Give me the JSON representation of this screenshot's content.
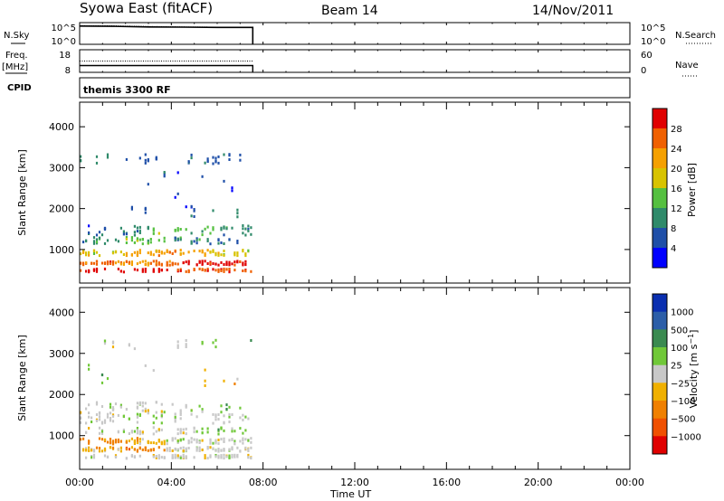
{
  "header": {
    "station": "Syowa East (fitACF)",
    "beam": "Beam 14",
    "date": "14/Nov/2011"
  },
  "chart_data": [
    {
      "type": "line",
      "panel": "noise",
      "left_label": "N.Sky",
      "right_label": "N.Search",
      "left_ticks": [
        "10^5",
        "10^0"
      ],
      "right_ticks": [
        "10^5",
        "10^0"
      ],
      "x_range_hours": [
        0,
        24
      ],
      "data_end_hours": 7.55,
      "series": [
        {
          "style": "solid",
          "values": [
            0.84,
            0.83,
            0.8,
            0.79,
            0.78,
            0.78
          ]
        },
        {
          "style": "dotted",
          "values": [
            0.86,
            0.85,
            0.82,
            0.8,
            0.79,
            0.79
          ]
        }
      ]
    },
    {
      "type": "line",
      "panel": "frequency",
      "left_label": "Freq.",
      "left_unit": "[MHz]",
      "right_label": "Nave",
      "left_ticks": [
        "18",
        "8"
      ],
      "right_ticks": [
        "60",
        "0"
      ],
      "x_range_hours": [
        0,
        24
      ],
      "data_end_hours": 7.55,
      "series": [
        {
          "style": "solid",
          "values": [
            0.3,
            0.3,
            0.3,
            0.3,
            0.3,
            0.3
          ]
        },
        {
          "style": "dotted",
          "values": [
            0.5,
            0.5,
            0.5,
            0.5,
            0.5,
            0.5
          ]
        }
      ]
    },
    {
      "type": "text",
      "panel": "cpid",
      "label": "CPID",
      "program": "themis 3300 RF"
    },
    {
      "type": "heatmap",
      "panel": "power",
      "ylabel": "Slant Range [km]",
      "yticks": [
        1000,
        2000,
        3000,
        4000
      ],
      "ylim": [
        180,
        4600
      ],
      "x_range_hours": [
        0,
        24
      ],
      "data_end_hours": 7.55,
      "colorbar": {
        "label": "Power [dB]",
        "ticks": [
          "4",
          "8",
          "12",
          "16",
          "20",
          "24",
          "28"
        ],
        "colors": [
          "#0000ff",
          "#1f4fa8",
          "#2f8a6a",
          "#55c040",
          "#d8c300",
          "#f5a000",
          "#f06000",
          "#e00000"
        ]
      },
      "bands": [
        {
          "km": 3250,
          "spread": 120,
          "levels": [
            2,
            1,
            1,
            1,
            1
          ],
          "density": 0.25
        },
        {
          "km": 2600,
          "spread": 350,
          "levels": [
            1,
            1,
            1,
            1
          ],
          "density": 0.12
        },
        {
          "km": 1950,
          "spread": 150,
          "levels": [
            1,
            1,
            2
          ],
          "density": 0.15
        },
        {
          "km": 1500,
          "spread": 120,
          "levels": [
            1,
            2,
            3,
            3,
            2
          ],
          "density": 0.6
        },
        {
          "km": 1250,
          "spread": 80,
          "levels": [
            2,
            3,
            2,
            1
          ],
          "density": 0.55
        },
        {
          "km": 950,
          "spread": 70,
          "levels": [
            4,
            5,
            5,
            4
          ],
          "density": 0.8
        },
        {
          "km": 700,
          "spread": 50,
          "levels": [
            6,
            5,
            6,
            7,
            7
          ],
          "density": 0.85
        },
        {
          "km": 520,
          "spread": 40,
          "levels": [
            7,
            6
          ],
          "density": 0.6
        }
      ]
    },
    {
      "type": "heatmap",
      "panel": "velocity",
      "ylabel": "Slant Range [km]",
      "yticks": [
        1000,
        2000,
        3000,
        4000
      ],
      "ylim": [
        180,
        4600
      ],
      "x_range_hours": [
        0,
        24
      ],
      "data_end_hours": 7.55,
      "colorbar": {
        "label": "Velocity [m s^-1]",
        "ticks": [
          "1000",
          "500",
          "100",
          "25",
          "-25",
          "-100",
          "-500",
          "-1000"
        ],
        "colors": [
          "#0a2fb0",
          "#2c5ea8",
          "#3a8a50",
          "#70c838",
          "#c8c8c8",
          "#f0b000",
          "#f08000",
          "#f05000",
          "#e00000"
        ]
      },
      "bands": [
        {
          "km": 3250,
          "spread": 120,
          "levels": [
            4,
            4,
            3
          ],
          "density": 0.2
        },
        {
          "km": 2500,
          "spread": 300,
          "levels": [
            3,
            4,
            5
          ],
          "density": 0.12
        },
        {
          "km": 1700,
          "spread": 150,
          "levels": [
            4,
            4,
            3
          ],
          "density": 0.4
        },
        {
          "km": 1450,
          "spread": 120,
          "levels": [
            4,
            3,
            4,
            4
          ],
          "density": 0.6
        },
        {
          "km": 1150,
          "spread": 80,
          "levels": [
            4,
            4,
            3
          ],
          "density": 0.5
        },
        {
          "km": 900,
          "spread": 70,
          "levels": [
            6,
            5,
            4,
            4
          ],
          "density": 0.8
        },
        {
          "km": 700,
          "spread": 50,
          "levels": [
            5,
            6,
            4,
            4
          ],
          "density": 0.85
        },
        {
          "km": 520,
          "spread": 40,
          "levels": [
            4,
            4
          ],
          "density": 0.6
        }
      ]
    }
  ],
  "x_axis": {
    "label": "Time UT",
    "ticks": [
      "00:00",
      "04:00",
      "08:00",
      "12:00",
      "16:00",
      "20:00",
      "00:00"
    ]
  }
}
